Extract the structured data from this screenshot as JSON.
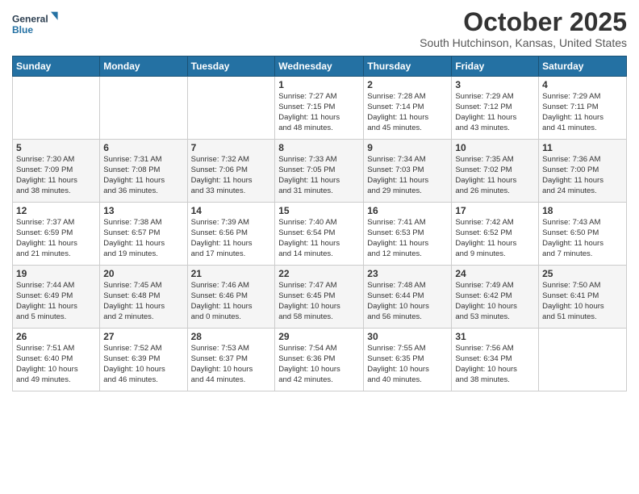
{
  "logo": {
    "line1": "General",
    "line2": "Blue"
  },
  "title": "October 2025",
  "subtitle": "South Hutchinson, Kansas, United States",
  "days_of_week": [
    "Sunday",
    "Monday",
    "Tuesday",
    "Wednesday",
    "Thursday",
    "Friday",
    "Saturday"
  ],
  "weeks": [
    [
      {
        "day": "",
        "info": ""
      },
      {
        "day": "",
        "info": ""
      },
      {
        "day": "",
        "info": ""
      },
      {
        "day": "1",
        "info": "Sunrise: 7:27 AM\nSunset: 7:15 PM\nDaylight: 11 hours\nand 48 minutes."
      },
      {
        "day": "2",
        "info": "Sunrise: 7:28 AM\nSunset: 7:14 PM\nDaylight: 11 hours\nand 45 minutes."
      },
      {
        "day": "3",
        "info": "Sunrise: 7:29 AM\nSunset: 7:12 PM\nDaylight: 11 hours\nand 43 minutes."
      },
      {
        "day": "4",
        "info": "Sunrise: 7:29 AM\nSunset: 7:11 PM\nDaylight: 11 hours\nand 41 minutes."
      }
    ],
    [
      {
        "day": "5",
        "info": "Sunrise: 7:30 AM\nSunset: 7:09 PM\nDaylight: 11 hours\nand 38 minutes."
      },
      {
        "day": "6",
        "info": "Sunrise: 7:31 AM\nSunset: 7:08 PM\nDaylight: 11 hours\nand 36 minutes."
      },
      {
        "day": "7",
        "info": "Sunrise: 7:32 AM\nSunset: 7:06 PM\nDaylight: 11 hours\nand 33 minutes."
      },
      {
        "day": "8",
        "info": "Sunrise: 7:33 AM\nSunset: 7:05 PM\nDaylight: 11 hours\nand 31 minutes."
      },
      {
        "day": "9",
        "info": "Sunrise: 7:34 AM\nSunset: 7:03 PM\nDaylight: 11 hours\nand 29 minutes."
      },
      {
        "day": "10",
        "info": "Sunrise: 7:35 AM\nSunset: 7:02 PM\nDaylight: 11 hours\nand 26 minutes."
      },
      {
        "day": "11",
        "info": "Sunrise: 7:36 AM\nSunset: 7:00 PM\nDaylight: 11 hours\nand 24 minutes."
      }
    ],
    [
      {
        "day": "12",
        "info": "Sunrise: 7:37 AM\nSunset: 6:59 PM\nDaylight: 11 hours\nand 21 minutes."
      },
      {
        "day": "13",
        "info": "Sunrise: 7:38 AM\nSunset: 6:57 PM\nDaylight: 11 hours\nand 19 minutes."
      },
      {
        "day": "14",
        "info": "Sunrise: 7:39 AM\nSunset: 6:56 PM\nDaylight: 11 hours\nand 17 minutes."
      },
      {
        "day": "15",
        "info": "Sunrise: 7:40 AM\nSunset: 6:54 PM\nDaylight: 11 hours\nand 14 minutes."
      },
      {
        "day": "16",
        "info": "Sunrise: 7:41 AM\nSunset: 6:53 PM\nDaylight: 11 hours\nand 12 minutes."
      },
      {
        "day": "17",
        "info": "Sunrise: 7:42 AM\nSunset: 6:52 PM\nDaylight: 11 hours\nand 9 minutes."
      },
      {
        "day": "18",
        "info": "Sunrise: 7:43 AM\nSunset: 6:50 PM\nDaylight: 11 hours\nand 7 minutes."
      }
    ],
    [
      {
        "day": "19",
        "info": "Sunrise: 7:44 AM\nSunset: 6:49 PM\nDaylight: 11 hours\nand 5 minutes."
      },
      {
        "day": "20",
        "info": "Sunrise: 7:45 AM\nSunset: 6:48 PM\nDaylight: 11 hours\nand 2 minutes."
      },
      {
        "day": "21",
        "info": "Sunrise: 7:46 AM\nSunset: 6:46 PM\nDaylight: 11 hours\nand 0 minutes."
      },
      {
        "day": "22",
        "info": "Sunrise: 7:47 AM\nSunset: 6:45 PM\nDaylight: 10 hours\nand 58 minutes."
      },
      {
        "day": "23",
        "info": "Sunrise: 7:48 AM\nSunset: 6:44 PM\nDaylight: 10 hours\nand 56 minutes."
      },
      {
        "day": "24",
        "info": "Sunrise: 7:49 AM\nSunset: 6:42 PM\nDaylight: 10 hours\nand 53 minutes."
      },
      {
        "day": "25",
        "info": "Sunrise: 7:50 AM\nSunset: 6:41 PM\nDaylight: 10 hours\nand 51 minutes."
      }
    ],
    [
      {
        "day": "26",
        "info": "Sunrise: 7:51 AM\nSunset: 6:40 PM\nDaylight: 10 hours\nand 49 minutes."
      },
      {
        "day": "27",
        "info": "Sunrise: 7:52 AM\nSunset: 6:39 PM\nDaylight: 10 hours\nand 46 minutes."
      },
      {
        "day": "28",
        "info": "Sunrise: 7:53 AM\nSunset: 6:37 PM\nDaylight: 10 hours\nand 44 minutes."
      },
      {
        "day": "29",
        "info": "Sunrise: 7:54 AM\nSunset: 6:36 PM\nDaylight: 10 hours\nand 42 minutes."
      },
      {
        "day": "30",
        "info": "Sunrise: 7:55 AM\nSunset: 6:35 PM\nDaylight: 10 hours\nand 40 minutes."
      },
      {
        "day": "31",
        "info": "Sunrise: 7:56 AM\nSunset: 6:34 PM\nDaylight: 10 hours\nand 38 minutes."
      },
      {
        "day": "",
        "info": ""
      }
    ]
  ]
}
